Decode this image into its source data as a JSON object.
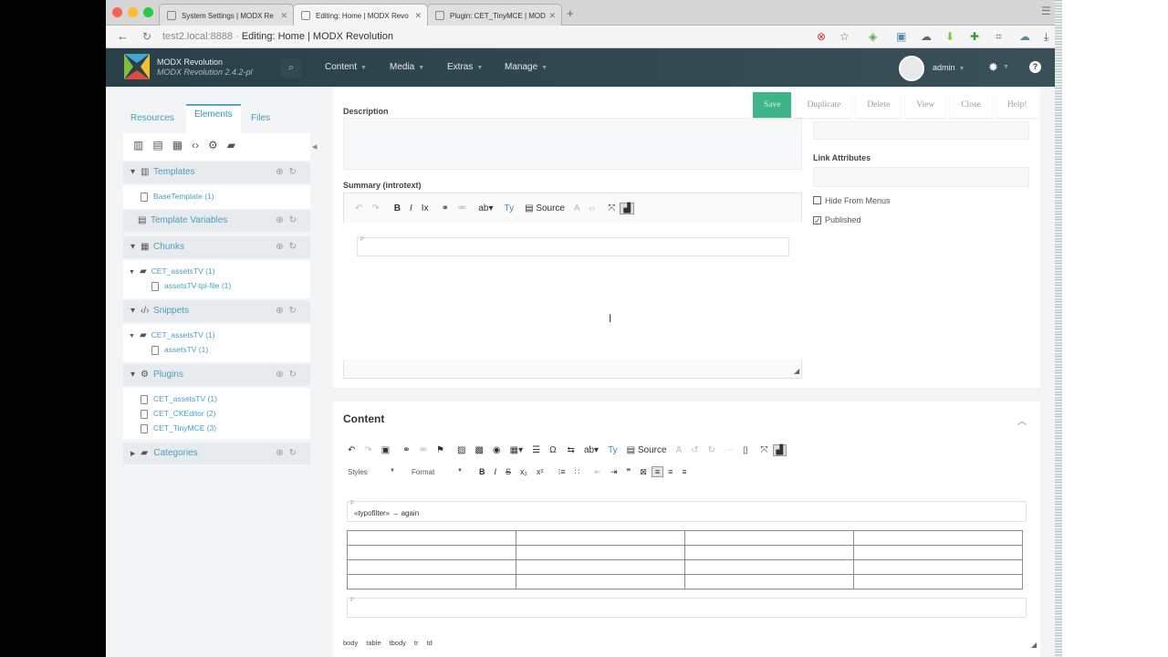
{
  "browser": {
    "tabs": [
      {
        "title": "System Settings | MODX Re"
      },
      {
        "title": "Editing: Home | MODX Revo"
      },
      {
        "title": "Plugin: CET_TinyMCE | MOD"
      }
    ],
    "url_host": "test2.local:8888",
    "url_title": "Editing: Home | MODX Revolution"
  },
  "header": {
    "brand_name": "MODX Revolution",
    "brand_version": "MODX Revolution 2.4.2-pl",
    "nav": [
      "Content",
      "Media",
      "Extras",
      "Manage"
    ],
    "user": "admin"
  },
  "sidebar": {
    "tabs": [
      "Resources",
      "Elements",
      "Files"
    ],
    "groups": {
      "templates": {
        "label": "Templates",
        "items": [
          "BaseTemplate (1)"
        ]
      },
      "tvs": {
        "label": "Template Variables"
      },
      "chunks": {
        "label": "Chunks",
        "category": "CET_assetsTV (1)",
        "items": [
          "assetsTV-tpl-file (1)"
        ]
      },
      "snippets": {
        "label": "Snippets",
        "category": "CET_assetsTV (1)",
        "items": [
          "assetsTV (1)"
        ]
      },
      "plugins": {
        "label": "Plugins",
        "items": [
          "CET_assetsTV (1)",
          "CET_CKEditor (2)",
          "CET_TinyMCE (3)"
        ]
      },
      "categories": {
        "label": "Categories"
      }
    }
  },
  "actions": [
    "Save",
    "Duplicate",
    "Delete",
    "View",
    "Close",
    "Help!"
  ],
  "form": {
    "description_label": "Description",
    "summary_label": "Summary (introtext)",
    "link_attributes_label": "Link Attributes",
    "hide_from_menus": "Hide From Menus",
    "published": "Published",
    "source_label": "Source",
    "content_heading": "Content",
    "styles_label": "Styles",
    "format_label": "Format",
    "content_text": "«typofilter» → again",
    "paragraph_marker": "P",
    "path": [
      "body",
      "table",
      "tbody",
      "tr",
      "td"
    ]
  },
  "colors": {
    "save": "#3eb489",
    "header": "#2e454e",
    "link": "#4a9ebc"
  }
}
